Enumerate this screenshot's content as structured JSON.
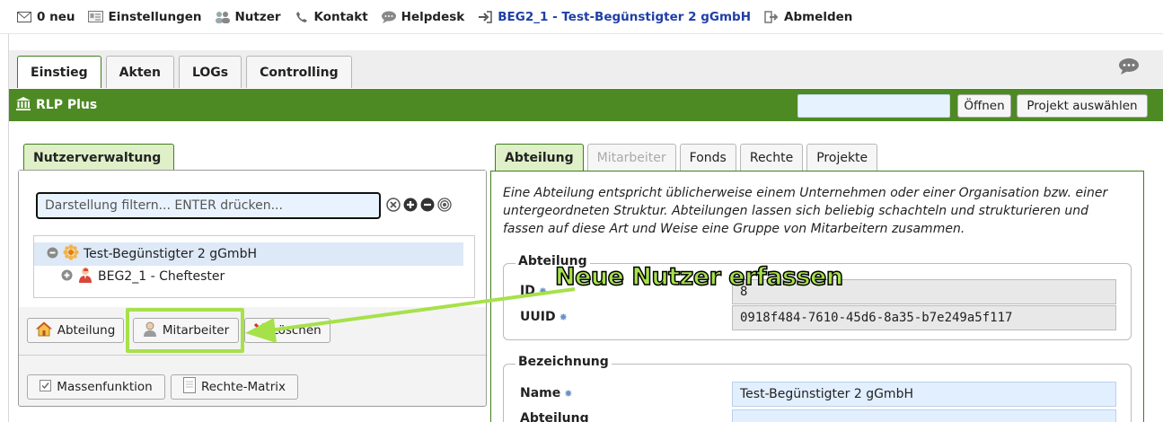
{
  "topnav": {
    "new_messages": "0 neu",
    "settings": "Einstellungen",
    "users": "Nutzer",
    "contact": "Kontakt",
    "helpdesk": "Helpdesk",
    "project": "BEG2_1 - Test-Begünstigter 2 gGmbH",
    "logout": "Abmelden"
  },
  "main_tabs": [
    {
      "label": "Einstieg",
      "active": true
    },
    {
      "label": "Akten"
    },
    {
      "label": "LOGs"
    },
    {
      "label": "Controlling"
    }
  ],
  "header": {
    "title": "RLP Plus",
    "open_button": "Öffnen",
    "select_project_button": "Projekt auswählen",
    "project_input_value": ""
  },
  "left_panel": {
    "tab": "Nutzerverwaltung",
    "filter_placeholder": "Darstellung filtern... ENTER drücken...",
    "tree": [
      {
        "label": "Test-Begünstigter 2 gGmbH",
        "icon": "organization-icon",
        "selected": true
      },
      {
        "label": "BEG2_1 - Cheftester",
        "icon": "user-icon"
      }
    ],
    "buttons": {
      "department": "Abteilung",
      "employee": "Mitarbeiter",
      "delete": "Löschen",
      "mass_function": "Massenfunktion",
      "rights_matrix": "Rechte-Matrix"
    }
  },
  "right_panel": {
    "tabs": [
      {
        "label": "Abteilung",
        "active": true
      },
      {
        "label": "Mitarbeiter",
        "disabled": true
      },
      {
        "label": "Fonds"
      },
      {
        "label": "Rechte"
      },
      {
        "label": "Projekte"
      }
    ],
    "description": "Eine Abteilung entspricht üblicherweise einem Unternehmen oder einer Organisation bzw. einer untergeordneten Struktur. Abteilungen lassen sich beliebig schachteln und strukturieren und fassen auf diese Art und Weise eine Gruppe von Mitarbeitern zusammen.",
    "fieldset_department": {
      "legend": "Abteilung",
      "id_label": "ID",
      "id_value": "8",
      "uuid_label": "UUID",
      "uuid_value": "0918f484-7610-45d6-8a35-b7e249a5f117"
    },
    "fieldset_name": {
      "legend": "Bezeichnung",
      "name_label": "Name",
      "name_value": "Test-Begünstigter 2 gGmbH",
      "department_label": "Abteilung"
    }
  },
  "annotation": {
    "text": "Neue Nutzer erfassen",
    "color": "#a6e14a"
  },
  "colors": {
    "brand_green": "#4e8a24",
    "highlight": "#a6e14a",
    "link_blue": "#1f3fa6"
  }
}
